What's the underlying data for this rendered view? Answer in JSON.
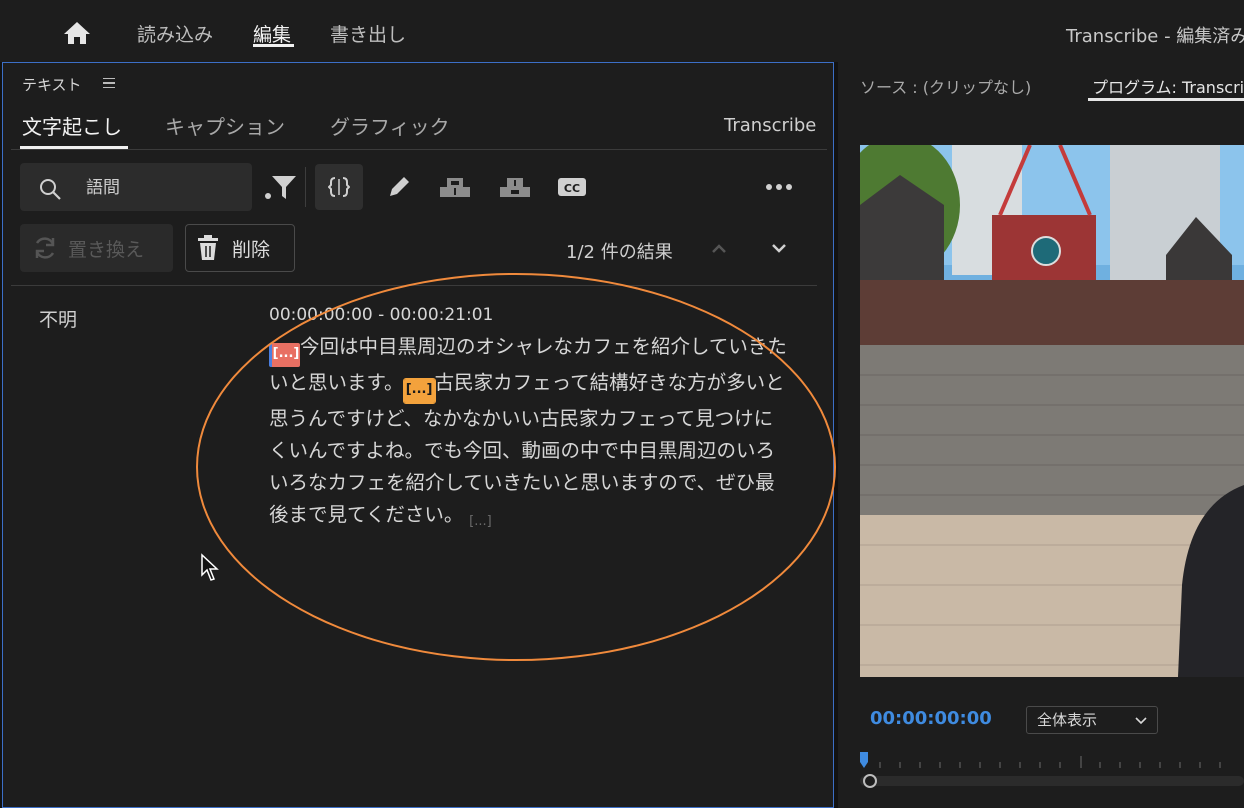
{
  "topnav": {
    "items": [
      "読み込み",
      "編集",
      "書き出し"
    ],
    "active": "編集",
    "app_title": "Transcribe - 編集済み"
  },
  "text_panel": {
    "title": "テキスト",
    "tabs": [
      "文字起こし",
      "キャプション",
      "グラフィック"
    ],
    "active_tab": "文字起こし",
    "sequence_name": "Transcribe",
    "search": {
      "value": "語間",
      "icon": "search-icon"
    },
    "tools": [
      "filter-icon",
      "split-icon",
      "pencil-icon",
      "merge-up-icon",
      "merge-down-icon",
      "cc-icon",
      "more-icon"
    ],
    "replace_label": "置き換え",
    "delete_label": "削除",
    "results": "1/2 件の結果",
    "entry": {
      "speaker": "不明",
      "timecode": "00:00:00:00 - 00:00:21:01",
      "gap_marker": "[...]",
      "text_1": "今回は中目黒周辺のオシャレなカフェを紹介していきたいと思います。",
      "text_2": "古民家カフェって結構好きな方が多いと思うんですけど、なかなかいい古民家カフェって見つけにくいんですよね。でも今回、動画の中で中目黒周辺のいろいろなカフェを紹介していきたいと思いますので、ぜひ最後まで見てください。"
    }
  },
  "monitor": {
    "source_tab": "ソース : (クリップなし)",
    "program_tab": "プログラム: Transcribe",
    "timecode": "00:00:00:00",
    "zoom": "全体表示"
  },
  "colors": {
    "accent_blue": "#3f8be0",
    "panel_border": "#3c6fc7",
    "annotation": "#f08a3c",
    "marker_red": "#e87063",
    "marker_orange": "#f3a23c"
  }
}
